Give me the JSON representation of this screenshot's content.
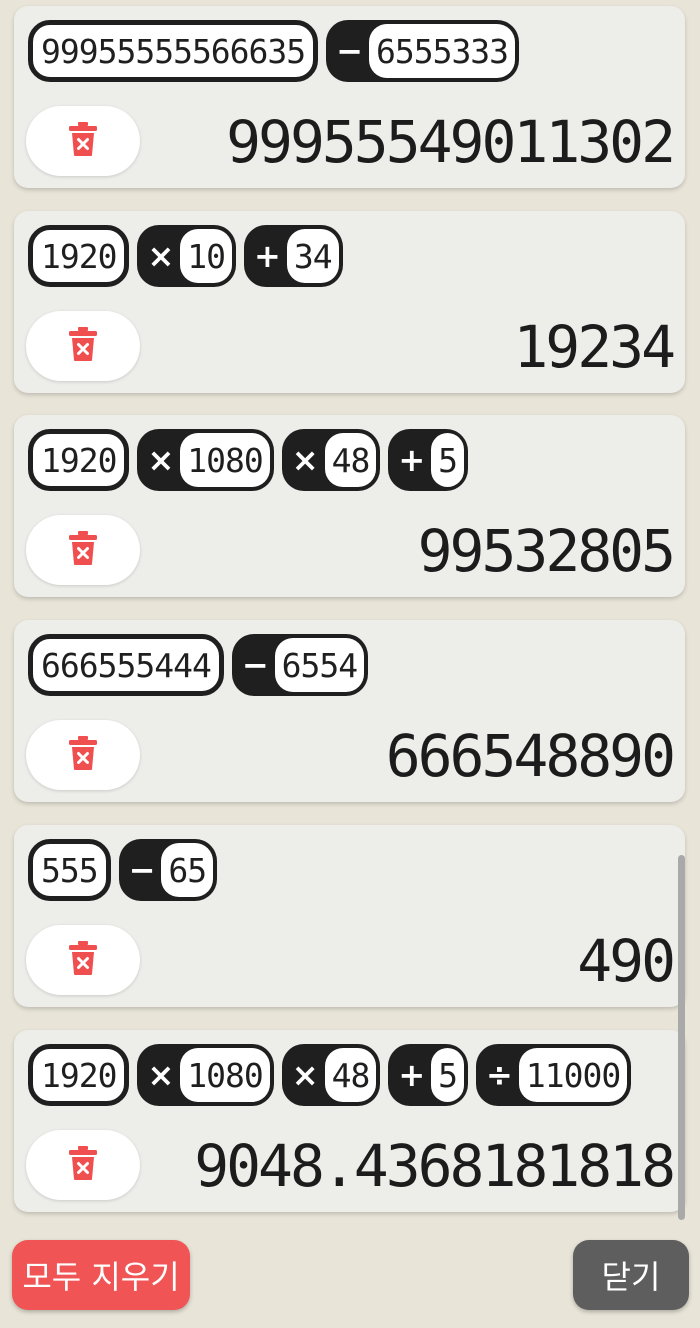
{
  "history": [
    {
      "tokens": [
        {
          "num": "99955555566635"
        },
        {
          "op": "−",
          "num": "6555333"
        }
      ],
      "result": "99955549011302"
    },
    {
      "tokens": [
        {
          "num": "1920"
        },
        {
          "op": "×",
          "num": "10"
        },
        {
          "op": "+",
          "num": "34"
        }
      ],
      "result": "19234"
    },
    {
      "tokens": [
        {
          "num": "1920"
        },
        {
          "op": "×",
          "num": "1080"
        },
        {
          "op": "×",
          "num": "48"
        },
        {
          "op": "+",
          "num": "5"
        }
      ],
      "result": "99532805"
    },
    {
      "tokens": [
        {
          "num": "666555444"
        },
        {
          "op": "−",
          "num": "6554"
        }
      ],
      "result": "666548890"
    },
    {
      "tokens": [
        {
          "num": "555"
        },
        {
          "op": "−",
          "num": "65"
        }
      ],
      "result": "490"
    },
    {
      "tokens": [
        {
          "num": "1920"
        },
        {
          "op": "×",
          "num": "1080"
        },
        {
          "op": "×",
          "num": "48"
        },
        {
          "op": "+",
          "num": "5"
        },
        {
          "op": "÷",
          "num": "11000"
        }
      ],
      "result": "9048.4368181818"
    }
  ],
  "footer": {
    "clear_all_label": "모두 지우기",
    "close_label": "닫기"
  },
  "icons": {
    "delete": "trash-x-icon"
  },
  "colors": {
    "delete_icon": "#f04f4f",
    "chip_dark": "#1f1f1f",
    "clear_all_bg": "#f05454",
    "close_bg": "#5e5e5e"
  }
}
